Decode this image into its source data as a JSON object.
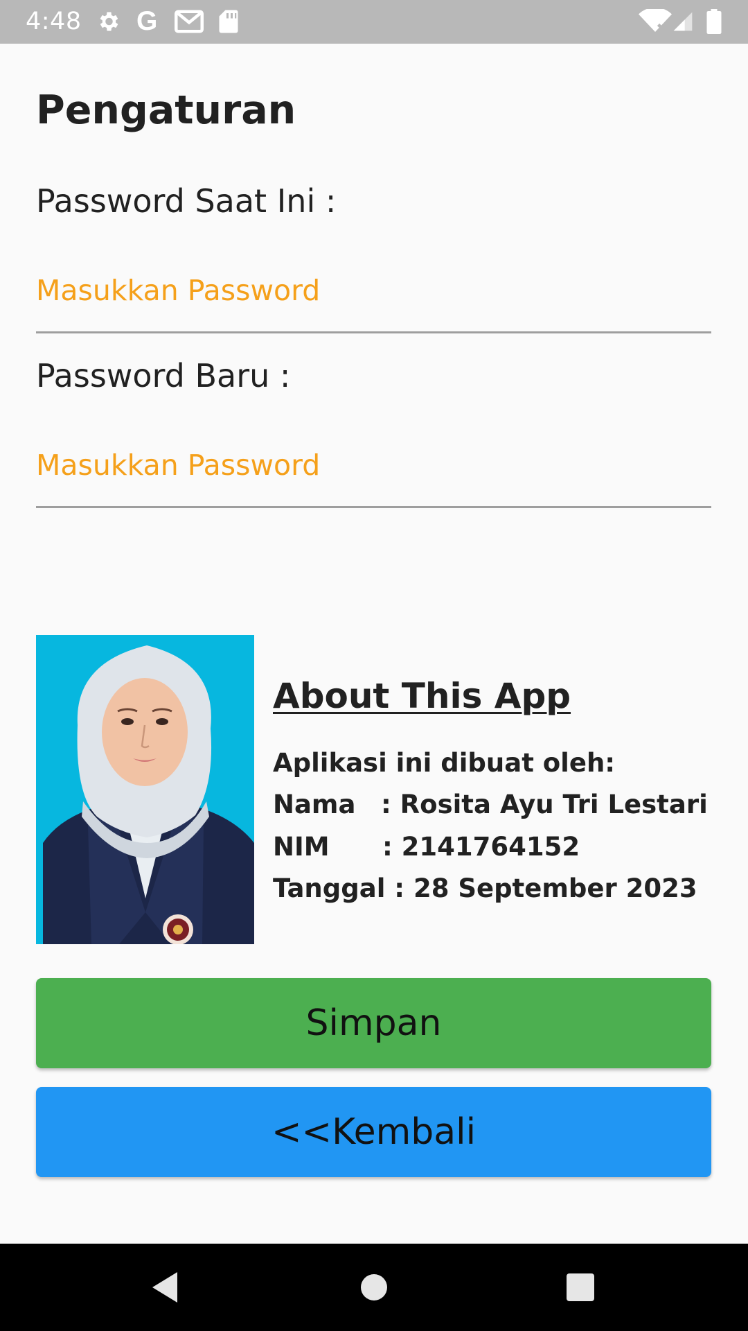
{
  "status_bar": {
    "time": "4:48",
    "icons": [
      "gear-icon",
      "google-icon",
      "gmail-icon",
      "sd-card-icon",
      "wifi-icon",
      "signal-icon",
      "battery-icon"
    ],
    "google_glyph": "G"
  },
  "settings": {
    "title": "Pengaturan",
    "current_password_label": "Password Saat Ini :",
    "current_password_placeholder": "Masukkan Password",
    "current_password_value": "",
    "new_password_label": "Password Baru :",
    "new_password_placeholder": "Masukkan Password",
    "new_password_value": ""
  },
  "about": {
    "title": "About This App",
    "made_by": "Aplikasi ini dibuat oleh:",
    "name_key": "Nama",
    "name_value": ": Rosita Ayu Tri Lestari",
    "nim_key": "NIM",
    "nim_value": ": 2141764152",
    "date_text": "Tanggal : 28 September 2023"
  },
  "buttons": {
    "save_label": "Simpan",
    "back_label": "<<Kembali"
  },
  "colors": {
    "status_bar": "#b8b8b8",
    "placeholder": "#f5a01a",
    "save_button": "#4caf50",
    "back_button": "#2196f3",
    "photo_background": "#07b7df"
  },
  "nav_bar": {
    "icons": [
      "back-triangle-icon",
      "home-circle-icon",
      "recents-square-icon"
    ]
  }
}
